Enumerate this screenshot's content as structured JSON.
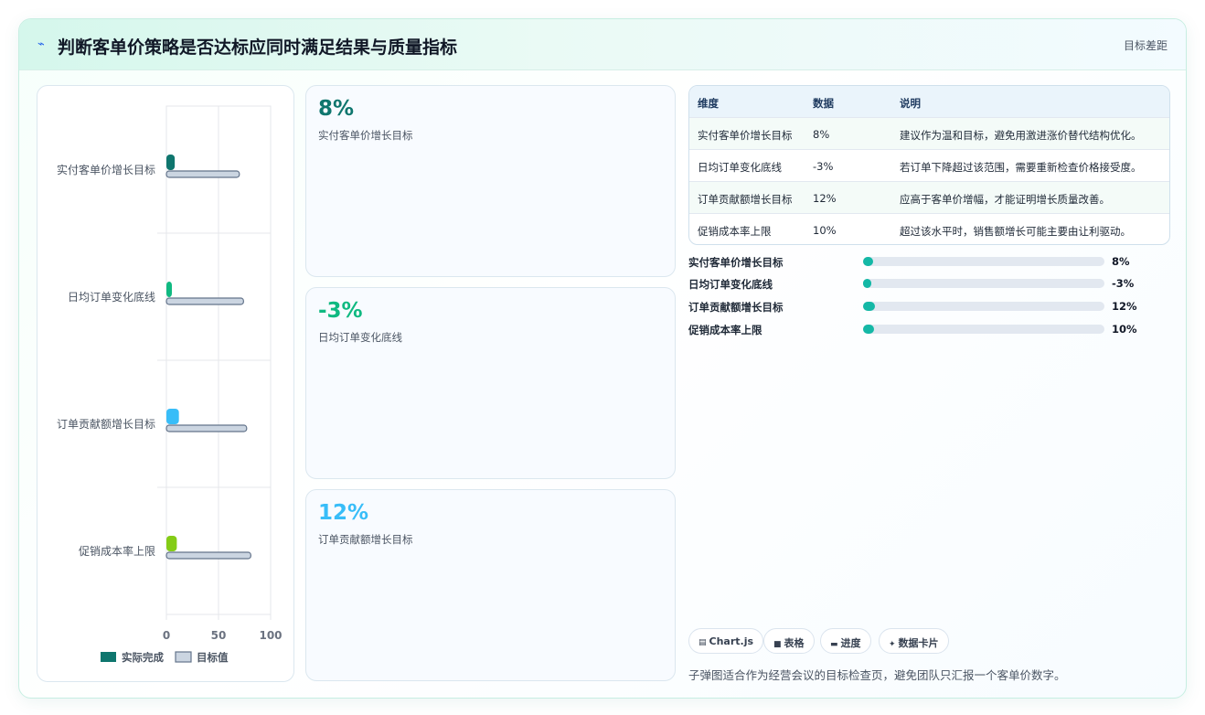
{
  "header": {
    "icon": "sparkle-icon",
    "title": "判断客单价策略是否达标应同时满足结果与质量指标",
    "right_label": "目标差距"
  },
  "colors": {
    "actual": "#0f766e",
    "target": "#cbd5e1",
    "kpi1": "#0f766e",
    "kpi2": "#10b981",
    "kpi3": "#38bdf8",
    "progress": "#14b8a6"
  },
  "chart_data": {
    "type": "bar",
    "orientation": "horizontal",
    "categories": [
      "实付客单价增长目标",
      "日均订单变化底线",
      "订单贡献额增长目标",
      "促销成本率上限"
    ],
    "series": [
      {
        "name": "实际完成",
        "values": [
          8,
          -3,
          12,
          10
        ],
        "colors": [
          "#0f766e",
          "#10b981",
          "#38bdf8",
          "#84cc16"
        ]
      },
      {
        "name": "目标值",
        "values": [
          70,
          74,
          77,
          81
        ],
        "color": "#cbd5e1"
      }
    ],
    "x_ticks": [
      "0",
      "50",
      "100"
    ],
    "xlim": [
      0,
      100
    ],
    "legend_position": "bottom",
    "grid": true
  },
  "kpis": [
    {
      "value": "8%",
      "label": "实付客单价增长目标"
    },
    {
      "value": "-3%",
      "label": "日均订单变化底线"
    },
    {
      "value": "12%",
      "label": "订单贡献额增长目标"
    }
  ],
  "table": {
    "headers": [
      "维度",
      "数据",
      "说明"
    ],
    "rows": [
      [
        "实付客单价增长目标",
        "8%",
        "建议作为温和目标，避免用激进涨价替代结构优化。"
      ],
      [
        "日均订单变化底线",
        "-3%",
        "若订单下降超过该范围，需要重新检查价格接受度。"
      ],
      [
        "订单贡献额增长目标",
        "12%",
        "应高于客单价增幅，才能证明增长质量改善。"
      ],
      [
        "促销成本率上限",
        "10%",
        "超过该水平时，销售额增长可能主要由让利驱动。"
      ]
    ]
  },
  "progress": [
    {
      "label": "实付客单价增长目标",
      "value_text": "8%",
      "fraction": 0.04
    },
    {
      "label": "日均订单变化底线",
      "value_text": "-3%",
      "fraction": 0.035
    },
    {
      "label": "订单贡献额增长目标",
      "value_text": "12%",
      "fraction": 0.05
    },
    {
      "label": "促销成本率上限",
      "value_text": "10%",
      "fraction": 0.045
    }
  ],
  "tags": [
    {
      "icon": "chart-icon",
      "glyph": "▤",
      "label": "Chart.js"
    },
    {
      "icon": "table-icon",
      "glyph": "■",
      "label": "表格"
    },
    {
      "icon": "progress-icon",
      "glyph": "▬",
      "label": "进度"
    },
    {
      "icon": "data-card-icon",
      "glyph": "✦",
      "label": "数据卡片"
    }
  ],
  "footnote": "子弹图适合作为经营会议的目标检查页，避免团队只汇报一个客单价数字。"
}
